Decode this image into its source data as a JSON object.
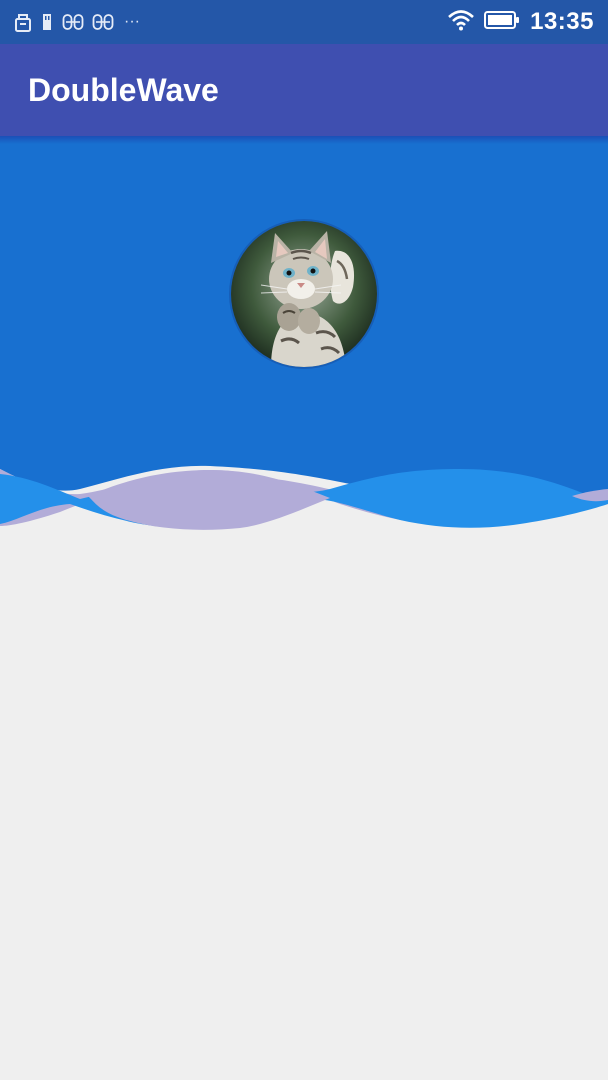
{
  "status_bar": {
    "time": "13:35",
    "more_indicator": "···",
    "icons": [
      "usb-debug-icon",
      "sd-card-icon",
      "notification-icon",
      "notification-icon",
      "wifi-icon",
      "battery-icon"
    ]
  },
  "app_bar": {
    "title": "DoubleWave"
  },
  "avatar": {
    "subject": "kitten-avatar"
  },
  "colors": {
    "status_bar": "#2457a8",
    "app_bar": "#3f4fb0",
    "header": "#1870d0",
    "wave_front": "#2490ea",
    "wave_back": "#b2acd8",
    "background": "#efefef"
  }
}
